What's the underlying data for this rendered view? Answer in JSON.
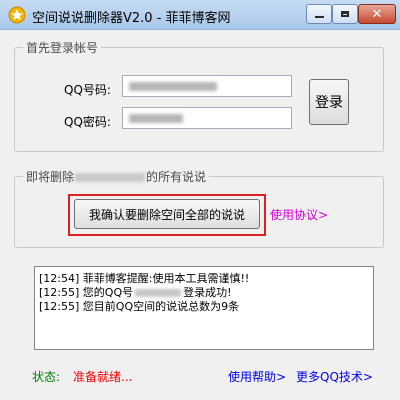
{
  "window": {
    "title": "空间说说删除器V2.0 - 菲菲博客网",
    "colors": {
      "titlebar": "#b7d1ef",
      "accent_red": "#e02020",
      "link_blue": "#0000ee",
      "link_magenta": "#d800d8",
      "status_green": "#008000",
      "status_red": "#ff0000"
    }
  },
  "login": {
    "group_title": "首先登录帐号",
    "qq_label": "QQ号码:",
    "password_label": "QQ密码:",
    "login_button": "登录"
  },
  "delete": {
    "group_title_prefix": "即将删除",
    "group_title_suffix": "的所有说说",
    "confirm_button": "我确认要删除空间全部的说说",
    "usage_link": "使用协议>"
  },
  "log": {
    "lines": [
      {
        "time": "[12:54]",
        "text": "菲菲博客提醒:使用本工具需谨慎!!"
      },
      {
        "time": "[12:55]",
        "prefix": "您的QQ号",
        "suffix": "登录成功!"
      },
      {
        "time": "[12:55]",
        "text": "您目前QQ空间的说说总数为9条"
      }
    ]
  },
  "footer": {
    "status_label": "状态:",
    "status_value": "准备就绪...",
    "help_link": "使用帮助>",
    "more_link": "更多QQ技术>"
  }
}
